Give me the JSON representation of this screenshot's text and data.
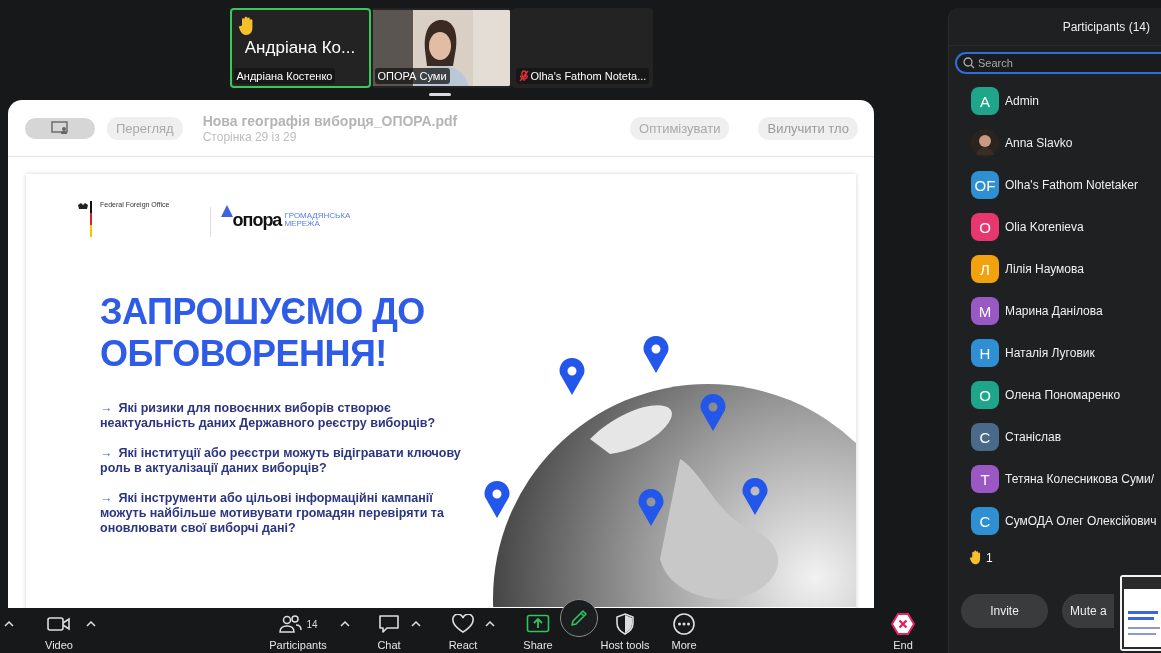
{
  "video_tiles": [
    {
      "kind": "avatar",
      "name_large": "Андріана Ко...",
      "label": "Андріана Костенко",
      "active_speaker": true,
      "hand_raised": true,
      "muted": false
    },
    {
      "kind": "camera",
      "label": "ОПОРА Суми",
      "active_speaker": false,
      "hand_raised": false,
      "muted": false
    },
    {
      "kind": "screen",
      "label": "Olha's Fathom Noteta...",
      "active_speaker": false,
      "hand_raised": false,
      "muted": true
    }
  ],
  "viewer": {
    "view_button": "Перегляд",
    "file_title": "Нова географія виборця_ОПОРА.pdf",
    "page_info": "Сторінка 29 із 29",
    "optimize_button": "Оптимізувати",
    "remove_bg_button": "Вилучити тло"
  },
  "slide": {
    "partner_name": "Federal Foreign Office",
    "logo_text": "опора",
    "logo_subtitle": "ГРОМАДЯНСЬКА МЕРЕЖА",
    "heading": "ЗАПРОШУЄМО ДО ОБГОВОРЕННЯ!",
    "questions": [
      {
        "marker": "→",
        "text": "Які ризики для повоєнних виборів створює неактуальність даних Державного реєстру виборців?"
      },
      {
        "marker": "→",
        "text": "Які інституції або реєстри можуть відігравати ключову роль в актуалізації даних виборців?"
      },
      {
        "marker": "→",
        "text": "Які інструменти або цільові інформаційні кампанії можуть найбільше мотивувати громадян перевіряти та оновлювати свої виборчі дані?"
      }
    ]
  },
  "panel": {
    "title": "Participants (14)",
    "search": {
      "placeholder": "Search"
    },
    "participants": [
      {
        "kind": "initials",
        "initials": "A",
        "name": "Admin",
        "color": "#1fa58a"
      },
      {
        "name": "Anna Slavko"
      },
      {
        "kind": "initials",
        "initials": "OF",
        "name": "Olha's Fathom Notetaker",
        "color": "#2f8fd3"
      },
      {
        "kind": "initials",
        "initials": "O",
        "name": "Olia Korenieva",
        "color": "#e6386e"
      },
      {
        "kind": "initials",
        "initials": "Л",
        "name": "Лілія Наумова",
        "color": "#f2a20c"
      },
      {
        "kind": "initials",
        "initials": "М",
        "name": "Марина Данілова",
        "color": "#9a58c4"
      },
      {
        "kind": "initials",
        "initials": "Н",
        "name": "Наталія Луговик",
        "color": "#2f8fd3"
      },
      {
        "kind": "initials",
        "initials": "О",
        "name": "Олена Пономаренко",
        "color": "#1fa58a"
      },
      {
        "kind": "initials",
        "initials": "С",
        "name": "Станіслав",
        "color": "#4a6a8a"
      },
      {
        "kind": "initials",
        "initials": "Т",
        "name": "Тетяна  Колесникова Суми/",
        "color": "#9a58c4"
      },
      {
        "kind": "initials",
        "initials": "С",
        "name": "СумОДА Олег Олексійович",
        "color": "#2f8fd3"
      }
    ],
    "raised_hands": "1",
    "buttons": [
      "Invite",
      "Mute a"
    ]
  },
  "toolbar": {
    "items": [
      {
        "kind": "caret"
      },
      {
        "kind": "video",
        "label": "Video",
        "has_menu": true
      },
      {
        "kind": "participants",
        "label": "Participants",
        "count": "14",
        "has_menu": true
      },
      {
        "kind": "chat",
        "label": "Chat",
        "has_menu": true
      },
      {
        "kind": "react",
        "label": "React",
        "has_menu": true
      },
      {
        "kind": "share",
        "label": "Share",
        "has_menu": false
      },
      {
        "kind": "host-tools",
        "label": "Host tools",
        "has_menu": false
      },
      {
        "kind": "more",
        "label": "More",
        "has_menu": false
      },
      {
        "kind": "end",
        "label": "End",
        "has_menu": false
      }
    ]
  }
}
